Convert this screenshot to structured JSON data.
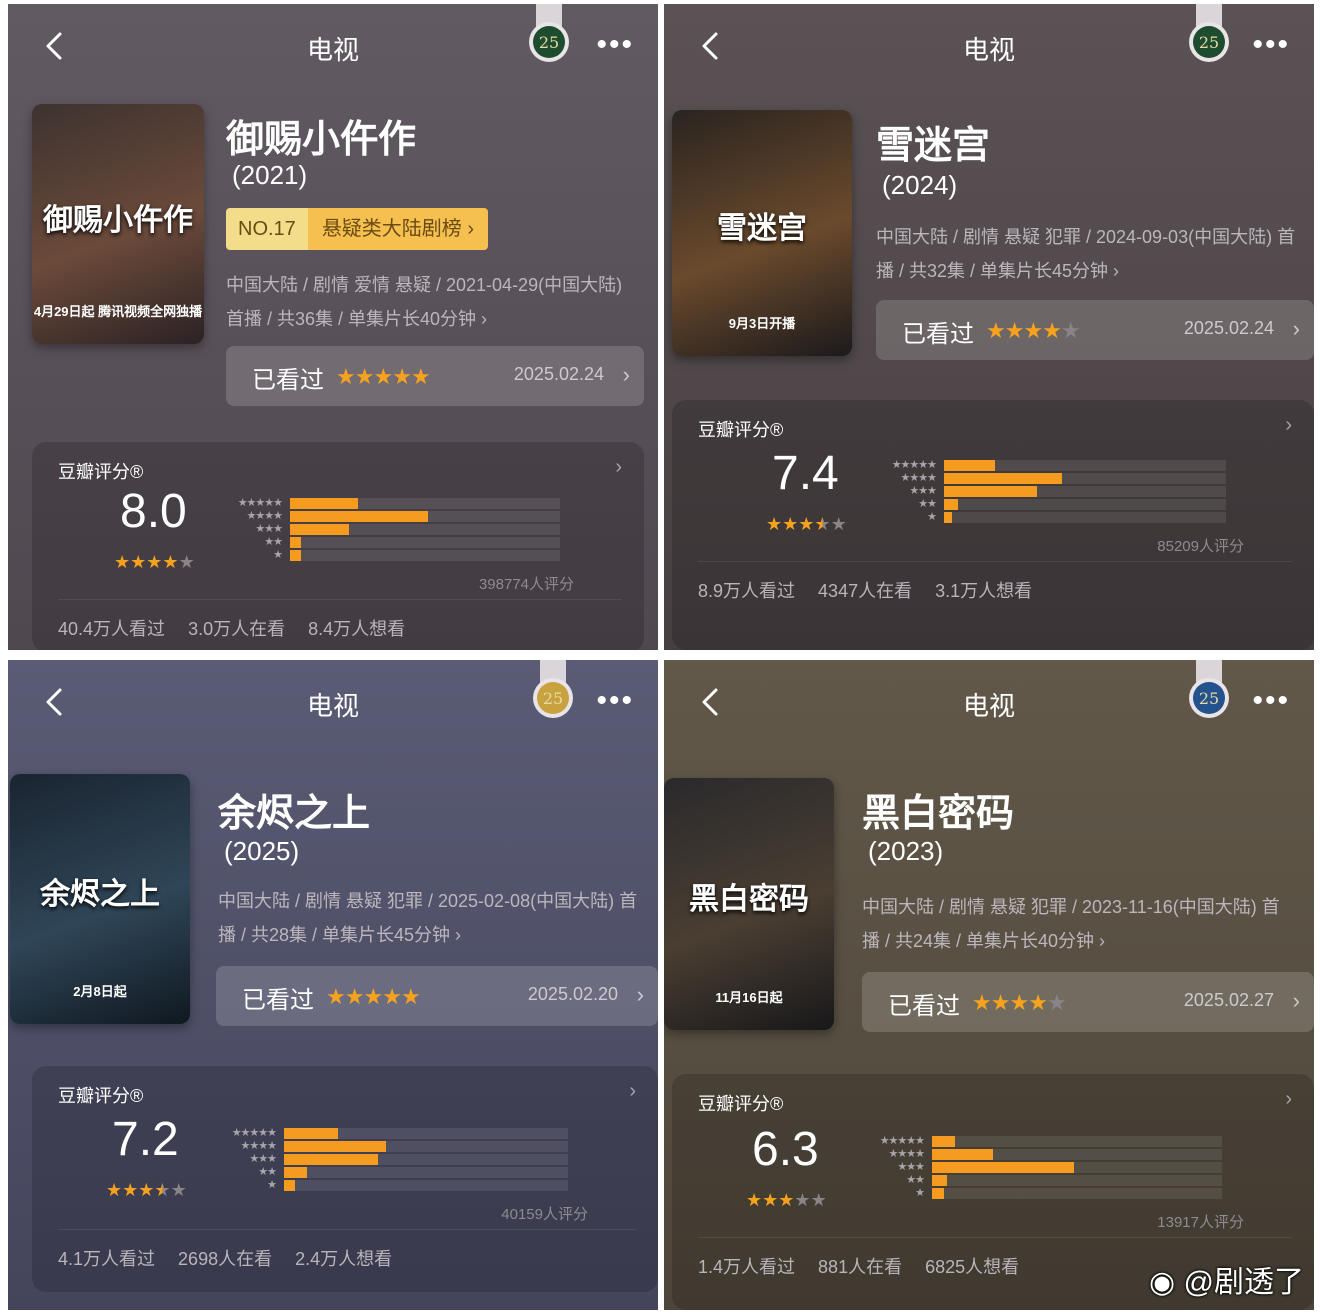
{
  "nav": {
    "title": "电视",
    "more": "•••"
  },
  "panels": [
    {
      "title": "御赐小仵作",
      "year": "(2021)",
      "rank": {
        "no": "NO.17",
        "category": "悬疑类大陆剧榜 ›"
      },
      "meta": "中国大陆 / 剧情 爱情 悬疑 / 2021-04-29(中国大陆) 首播 / 共36集 / 单集片长40分钟 ›",
      "watched": {
        "label": "已看过",
        "stars": 5,
        "date": "2025.02.24"
      },
      "douban": {
        "label": "豆瓣评分®",
        "score": "8.0",
        "stars": 4,
        "count": "398774人评分",
        "distribution": [
          0.25,
          0.51,
          0.22,
          0.04,
          0.04
        ],
        "stats": [
          "40.4万人看过",
          "3.0万人在看",
          "8.4万人想看"
        ]
      },
      "poster": {
        "text": "御赐小仵作",
        "sub": "4月29日起 腾讯视频全网独播",
        "colors": [
          "#3d3330",
          "#6b4a3a",
          "#2b2224"
        ]
      }
    },
    {
      "title": "雪迷宫",
      "year": "(2024)",
      "meta": "中国大陆 / 剧情 悬疑 犯罪 / 2024-09-03(中国大陆) 首播 / 共32集 / 单集片长45分钟 ›",
      "watched": {
        "label": "已看过",
        "stars": 4,
        "date": "2025.02.24"
      },
      "douban": {
        "label": "豆瓣评分®",
        "score": "7.4",
        "stars": 3.5,
        "count": "85209人评分",
        "distribution": [
          0.18,
          0.42,
          0.33,
          0.05,
          0.02
        ],
        "stats": [
          "8.9万人看过",
          "4347人在看",
          "3.1万人想看"
        ]
      },
      "poster": {
        "text": "雪迷宫",
        "sub": "9月3日开播",
        "colors": [
          "#2a2420",
          "#6a4a2c",
          "#1c1a1c"
        ]
      }
    },
    {
      "title": "余烬之上",
      "year": "(2025)",
      "meta": "中国大陆 / 剧情 悬疑 犯罪 / 2025-02-08(中国大陆) 首播 / 共28集 / 单集片长45分钟 ›",
      "watched": {
        "label": "已看过",
        "stars": 5,
        "date": "2025.02.20"
      },
      "douban": {
        "label": "豆瓣评分®",
        "score": "7.2",
        "stars": 3.5,
        "count": "40159人评分",
        "distribution": [
          0.19,
          0.36,
          0.33,
          0.08,
          0.04
        ],
        "stats": [
          "4.1万人看过",
          "2698人在看",
          "2.4万人想看"
        ]
      },
      "poster": {
        "text": "余烬之上",
        "sub": "2月8日起",
        "colors": [
          "#1a2430",
          "#2f4658",
          "#101820"
        ]
      }
    },
    {
      "title": "黑白密码",
      "year": "(2023)",
      "meta": "中国大陆 / 剧情 悬疑 犯罪 / 2023-11-16(中国大陆) 首播 / 共24集 / 单集片长40分钟 ›",
      "watched": {
        "label": "已看过",
        "stars": 4,
        "date": "2025.02.27"
      },
      "douban": {
        "label": "豆瓣评分®",
        "score": "6.3",
        "stars": 3,
        "count": "13917人评分",
        "distribution": [
          0.08,
          0.21,
          0.49,
          0.05,
          0.04
        ],
        "stats": [
          "1.4万人看过",
          "881人在看",
          "6825人想看"
        ]
      },
      "poster": {
        "text": "黑白密码",
        "sub": "11月16日起",
        "colors": [
          "#2a2a2c",
          "#4a3e32",
          "#18181a"
        ]
      }
    }
  ],
  "watermark": "@剧透了",
  "colors": {
    "accent": "#f59b1f",
    "rank_gold": "#f5c04f"
  }
}
